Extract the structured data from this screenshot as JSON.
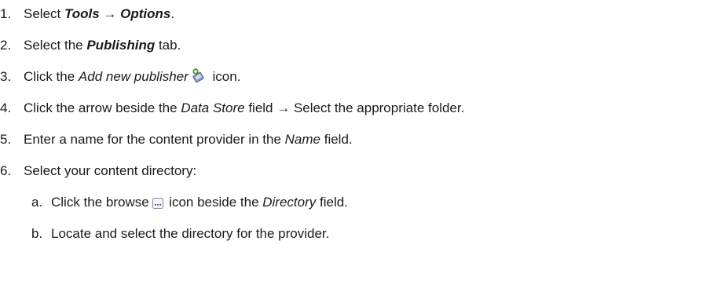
{
  "steps": [
    {
      "num": "1.",
      "pre": "Select ",
      "menu": "Tools",
      "arrow": "→",
      "item": "Options",
      "post": "."
    },
    {
      "num": "2.",
      "pre": "Select the ",
      "tab": "Publishing",
      "post": " tab."
    },
    {
      "num": "3.",
      "pre": "Click the ",
      "ui": "Add new publisher",
      "post": " icon.",
      "icon": "add-publisher-icon"
    },
    {
      "num": "4.",
      "pre": "Click the arrow beside the ",
      "field": "Data Store",
      "mid": " field ",
      "arrow": "→",
      "post": " Select the appropriate folder."
    },
    {
      "num": "5.",
      "pre": "Enter a name for the content provider in the ",
      "field": "Name",
      "post": " field."
    },
    {
      "num": "6.",
      "text": "Select your content directory:"
    }
  ],
  "substeps": [
    {
      "num": "a.",
      "pre": "Click the browse ",
      "mid": " icon beside the ",
      "field": "Directory",
      "post": " field.",
      "icon": "browse-icon"
    },
    {
      "num": "b.",
      "text": "Locate and select the directory for the provider."
    }
  ]
}
